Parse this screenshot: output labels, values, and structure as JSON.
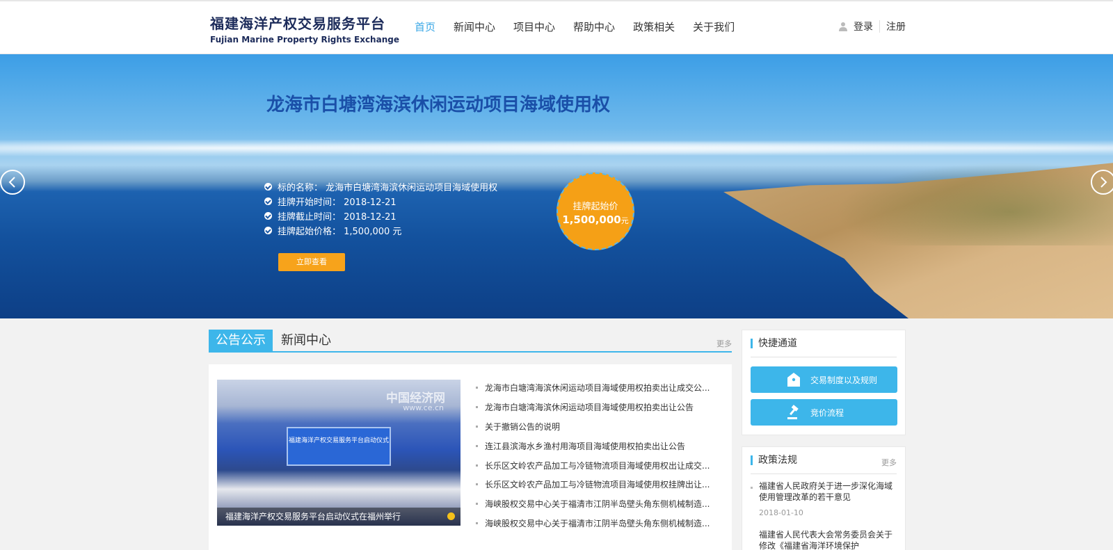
{
  "header": {
    "logo_cn": "福建海洋产权交易服务平台",
    "logo_en": "Fujian Marine Property Rights  Exchange",
    "nav": [
      "首页",
      "新闻中心",
      "项目中心",
      "帮助中心",
      "政策相关",
      "关于我们"
    ],
    "login": "登录",
    "register": "注册"
  },
  "banner": {
    "title": "龙海市白塘湾海滨休闲运动项目海域使用权",
    "info": [
      "标的名称： 龙海市白塘湾海滨休闲运动项目海域使用权",
      "挂牌开始时间： 2018-12-21",
      "挂牌截止时间： 2018-12-21",
      "挂牌起始价格： 1,500,000 元"
    ],
    "button": "立即查看",
    "price_label": "挂牌起始价",
    "price_value": "1,500,000",
    "price_unit": "元"
  },
  "announcements": {
    "tab_active": "公告公示",
    "tab_inactive": "新闻中心",
    "more": "更多",
    "photo_caption": "福建海洋产权交易服务平台启动仪式在福州举行",
    "photo_watermark": "中国经济网",
    "photo_watermark_url": "www.ce.cn",
    "photo_screen_text": "福建海洋产权交易服务平台启动仪式",
    "items": [
      "龙海市白塘湾海滨休闲运动项目海域使用权拍卖出让成交公...",
      "龙海市白塘湾海滨休闲运动项目海域使用权拍卖出让公告",
      "关于撤销公告的说明",
      "连江县滨海水乡渔村用海项目海域使用权拍卖出让公告",
      "长乐区文岭农产品加工与冷链物流项目海域使用权出让成交...",
      "长乐区文岭农产品加工与冷链物流项目海域使用权挂牌出让...",
      "海峡股权交易中心关于福清市江阴半岛壁头角东侧机械制造...",
      "海峡股权交易中心关于福清市江阴半岛壁头角东侧机械制造..."
    ]
  },
  "quick": {
    "title": "快捷通道",
    "btn1": "交易制度以及规则",
    "btn2": "竞价流程"
  },
  "policy": {
    "title": "政策法规",
    "more": "更多",
    "item1": "福建省人民政府关于进一步深化海域使用管理改革的若干意见",
    "item1_date": "2018-01-10",
    "item2": "福建省人民代表大会常务委员会关于修改《福建省海洋环境保护"
  },
  "colors": {
    "accent": "#3db6ea",
    "orange": "#f5a016",
    "nav_active": "#3aa7e6",
    "logo": "#1c2b5a"
  }
}
